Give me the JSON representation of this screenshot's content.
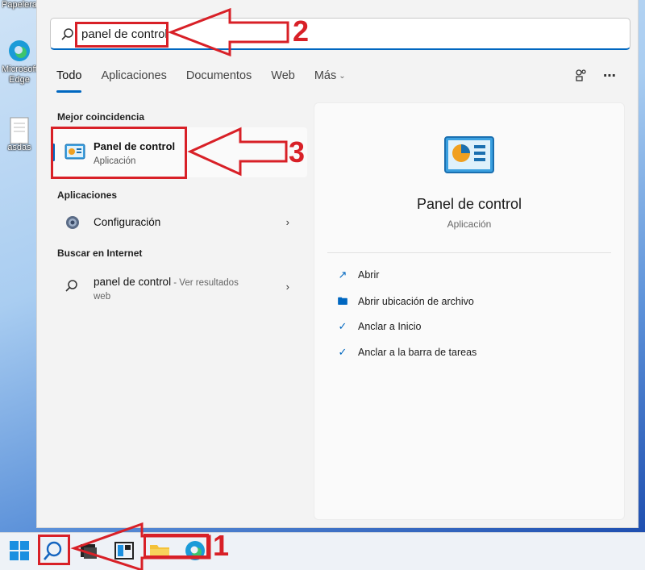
{
  "desktop": {
    "icons": [
      {
        "label": "Papelera de reciclaje"
      },
      {
        "label": "Microsoft Edge"
      },
      {
        "label": "asdas"
      }
    ]
  },
  "search": {
    "query": "panel de control"
  },
  "tabs": [
    {
      "label": "Todo",
      "active": true
    },
    {
      "label": "Aplicaciones"
    },
    {
      "label": "Documentos"
    },
    {
      "label": "Web"
    },
    {
      "label": "Más"
    }
  ],
  "header_icons": [
    "share-icon",
    "more-icon"
  ],
  "sections": {
    "best_match": "Mejor coincidencia",
    "apps": "Aplicaciones",
    "internet": "Buscar en Internet"
  },
  "best_match": {
    "name": "Panel de control",
    "type": "Aplicación"
  },
  "apps": [
    {
      "name": "Configuración",
      "icon": "gear-icon"
    }
  ],
  "internet": {
    "query": "panel de control",
    "suffix": " - Ver resultados",
    "suffix2": "web"
  },
  "detail": {
    "title": "Panel de control",
    "type": "Aplicación",
    "actions": [
      {
        "label": "Abrir",
        "icon": "open-external-icon"
      },
      {
        "label": "Abrir ubicación de archivo",
        "icon": "folder-icon"
      },
      {
        "label": "Anclar a Inicio",
        "icon": "pin-icon"
      },
      {
        "label": "Anclar a la barra de tareas",
        "icon": "pin-icon"
      }
    ]
  },
  "annotations": [
    "1",
    "2",
    "3"
  ],
  "colors": {
    "accent": "#0067c0",
    "annotation": "#d82027"
  }
}
